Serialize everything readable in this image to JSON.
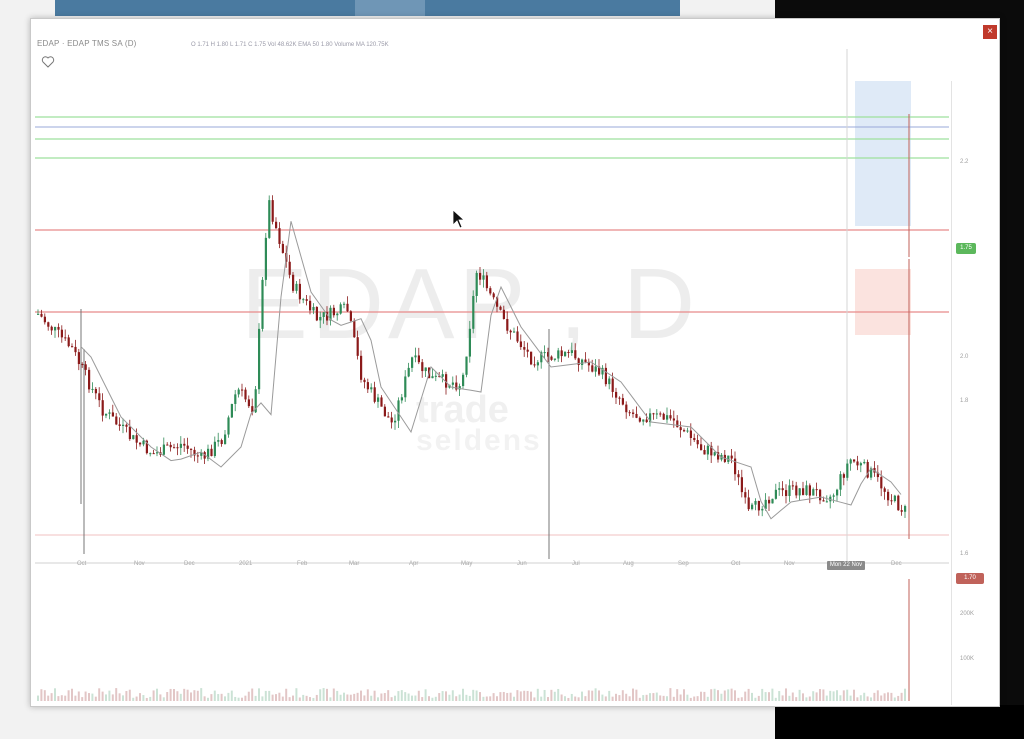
{
  "window": {
    "title": "EDAP · EDAP TMS SA (D)",
    "ohlc": "O 1.71  H 1.80  L 1.71  C 1.75   Vol 48.62K   EMA 50 1.80   Volume MA 120.75K"
  },
  "watermark": {
    "symbol": "EDAP , D",
    "line1": "trade",
    "line2": "seldens"
  },
  "colors": {
    "up_candle": "#2e8b57",
    "down_candle": "#8b1a1a",
    "resistance_line": "#e88a8a",
    "target_line": "#8fd48f",
    "blue_line": "#9aa8d8",
    "ma_line": "#9a9a9a",
    "position_profit": "#dfeaf7",
    "position_loss": "#fbe3df",
    "green_tag": "#5cb85c",
    "red_tag": "#c0625a"
  },
  "price_scale": {
    "labels": [
      "2.2",
      "2.0",
      "1.8",
      "1.6"
    ],
    "tags": [
      "1.75",
      "1.70"
    ]
  },
  "date_axis": {
    "labels": [
      "Oct",
      "Nov",
      "Dec",
      "2021",
      "Feb",
      "Mar",
      "Apr",
      "May",
      "Jun",
      "Jul",
      "Aug",
      "Sep",
      "Oct",
      "Nov",
      "Dec"
    ],
    "cursor_date": "Mon 22 Nov '21"
  },
  "volume_scale": {
    "labels": [
      "200K",
      "100K"
    ]
  },
  "icons": {
    "favorite": "heart-icon",
    "close": "close-icon",
    "cursor": "mouse-pointer-icon"
  }
}
